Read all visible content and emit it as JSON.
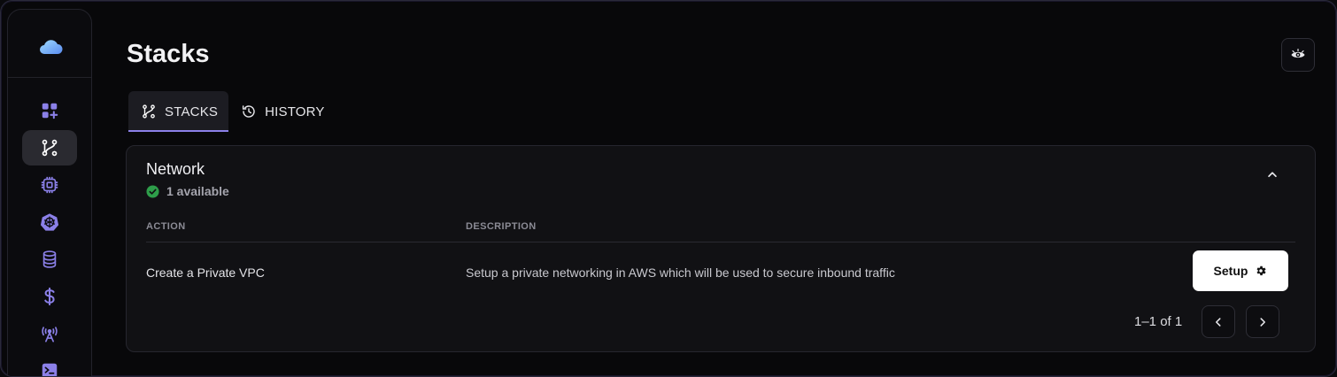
{
  "page": {
    "title": "Stacks"
  },
  "sidebar": {
    "logo": "cloud-logo",
    "items": [
      {
        "name": "apps",
        "icon": "apps-plus-icon",
        "active": false
      },
      {
        "name": "stacks",
        "icon": "stacks-icon",
        "active": true
      },
      {
        "name": "cpu",
        "icon": "cpu-icon",
        "active": false
      },
      {
        "name": "kubernetes",
        "icon": "kubernetes-icon",
        "active": false
      },
      {
        "name": "database",
        "icon": "database-icon",
        "active": false
      },
      {
        "name": "billing",
        "icon": "dollar-icon",
        "active": false
      },
      {
        "name": "broadcast",
        "icon": "broadcast-icon",
        "active": false
      },
      {
        "name": "terminal",
        "icon": "terminal-icon",
        "active": false
      }
    ],
    "accent": "#8b80e8"
  },
  "tabs": [
    {
      "label": "STACKS",
      "icon": "stacks-icon",
      "active": true
    },
    {
      "label": "HISTORY",
      "icon": "history-icon",
      "active": false
    }
  ],
  "top_right": {
    "icon": "eye-icon"
  },
  "card": {
    "title": "Network",
    "status": {
      "text": "1 available",
      "icon": "check-circle-icon",
      "color": "#2e9e4a"
    },
    "columns": {
      "action": "ACTION",
      "description": "DESCRIPTION"
    },
    "rows": [
      {
        "action": "Create a Private VPC",
        "description": "Setup a private networking in AWS which will be used to secure inbound traffic",
        "button_label": "Setup",
        "button_icon": "gear-icon"
      }
    ],
    "pagination": {
      "text": "1–1 of 1"
    }
  }
}
